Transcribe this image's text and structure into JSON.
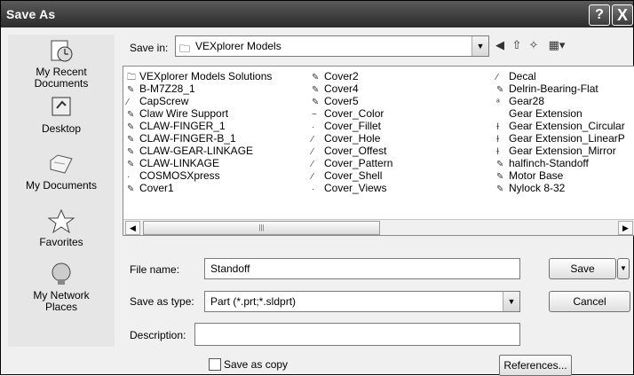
{
  "window": {
    "title": "Save As",
    "help_label": "?",
    "close_label": "X"
  },
  "places": [
    {
      "label": "My Recent\nDocuments",
      "icon": "recent-documents-icon"
    },
    {
      "label": "Desktop",
      "icon": "desktop-icon"
    },
    {
      "label": "My Documents",
      "icon": "my-documents-icon"
    },
    {
      "label": "Favorites",
      "icon": "favorites-icon"
    },
    {
      "label": "My Network\nPlaces",
      "icon": "network-places-icon"
    }
  ],
  "save_in": {
    "label": "Save in:",
    "value": "VEXplorer Models"
  },
  "files": {
    "col1": [
      "VEXplorer Models Solutions",
      "B-M7Z28_1",
      "CapScrew",
      "Claw Wire Support",
      "CLAW-FINGER_1",
      "CLAW-FINGER-B_1",
      "CLAW-GEAR-LINKAGE",
      "CLAW-LINKAGE",
      "COSMOSXpress",
      "Cover1"
    ],
    "col2": [
      "Cover2",
      "Cover4",
      "Cover5",
      "Cover_Color",
      "Cover_Fillet",
      "Cover_Hole",
      "Cover_Offest",
      "Cover_Pattern",
      "Cover_Shell",
      "Cover_Views"
    ],
    "col3": [
      "Decal",
      "Delrin-Bearing-Flat",
      "Gear28",
      "Gear Extension",
      "Gear Extension_Circular",
      "Gear Extension_LinearP",
      "Gear Extension_Mirror",
      "halfinch-Standoff",
      "Motor Base",
      "Nylock 8-32"
    ]
  },
  "file_name": {
    "label": "File name:",
    "value": "Standoff"
  },
  "save_as_type": {
    "label": "Save as type:",
    "value": "Part (*.prt;*.sldprt)"
  },
  "description": {
    "label": "Description:",
    "value": ""
  },
  "buttons": {
    "save": "Save",
    "cancel": "Cancel",
    "references": "References..."
  },
  "save_as_copy": {
    "label": "Save as copy",
    "checked": false
  }
}
